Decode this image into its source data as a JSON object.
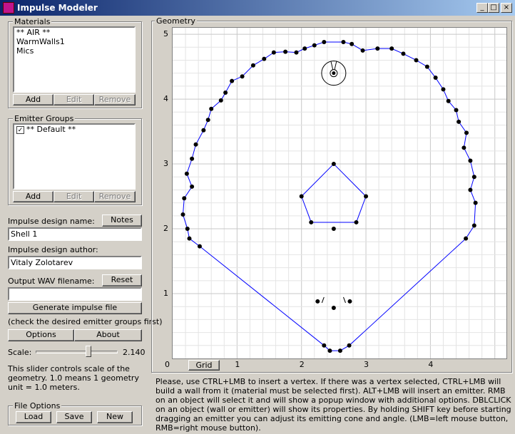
{
  "window": {
    "title": "Impulse Modeler",
    "minimize": "_",
    "maximize": "□",
    "close": "×"
  },
  "materials": {
    "legend": "Materials",
    "items": [
      "** AIR **",
      "WarmWalls1",
      "Mics"
    ],
    "add": "Add",
    "edit": "Edit",
    "remove": "Remove"
  },
  "emitter_groups": {
    "legend": "Emitter Groups",
    "items": [
      {
        "label": "** Default **",
        "checked": true
      }
    ],
    "check_mark": "✓",
    "add": "Add",
    "edit": "Edit",
    "remove": "Remove"
  },
  "design": {
    "name_label": "Impulse design name:",
    "notes": "Notes",
    "name_value": "Shell 1",
    "author_label": "Impulse design author:",
    "author_value": "Vitaly Zolotarev",
    "wav_label": "Output WAV filename:",
    "reset": "Reset",
    "wav_value": "",
    "generate": "Generate impulse file",
    "generate_hint": "(check the desired emitter groups first)",
    "options": "Options",
    "about": "About"
  },
  "scale": {
    "label": "Scale:",
    "value_text": "2.140",
    "slider_fraction": 0.64,
    "help": "This slider controls scale of the geometry. 1.0 means 1 geometry unit = 1.0 meters."
  },
  "file_options": {
    "legend": "File Options",
    "load": "Load",
    "save": "Save",
    "new": "New"
  },
  "geometry": {
    "legend": "Geometry",
    "grid_button": "Grid",
    "x_ticks": [
      "0",
      "1",
      "2",
      "3",
      "4"
    ],
    "y_ticks": [
      "1",
      "2",
      "3",
      "4",
      "5"
    ],
    "xlim": [
      0,
      5.18
    ],
    "ylim": [
      0,
      5.1
    ],
    "line_color": "#0000ff",
    "vertex_color": "#000000",
    "outer_wall": [
      [
        2.35,
        0.2
      ],
      [
        2.44,
        0.12
      ],
      [
        2.6,
        0.12
      ],
      [
        2.74,
        0.2
      ],
      [
        4.55,
        1.85
      ],
      [
        4.68,
        2.05
      ],
      [
        4.7,
        2.4
      ],
      [
        4.62,
        2.6
      ],
      [
        4.68,
        2.8
      ],
      [
        4.62,
        3.05
      ],
      [
        4.52,
        3.25
      ],
      [
        4.56,
        3.48
      ],
      [
        4.44,
        3.65
      ],
      [
        4.4,
        3.83
      ],
      [
        4.28,
        3.97
      ],
      [
        4.2,
        4.15
      ],
      [
        4.08,
        4.33
      ],
      [
        3.95,
        4.5
      ],
      [
        3.78,
        4.6
      ],
      [
        3.58,
        4.7
      ],
      [
        3.4,
        4.78
      ],
      [
        3.18,
        4.78
      ],
      [
        2.95,
        4.75
      ],
      [
        2.78,
        4.85
      ],
      [
        2.65,
        4.88
      ],
      [
        2.35,
        4.88
      ],
      [
        2.2,
        4.83
      ],
      [
        2.05,
        4.78
      ],
      [
        1.92,
        4.72
      ],
      [
        1.75,
        4.73
      ],
      [
        1.57,
        4.72
      ],
      [
        1.42,
        4.62
      ],
      [
        1.25,
        4.52
      ],
      [
        1.08,
        4.35
      ],
      [
        0.92,
        4.28
      ],
      [
        0.82,
        4.1
      ],
      [
        0.75,
        3.98
      ],
      [
        0.6,
        3.85
      ],
      [
        0.55,
        3.68
      ],
      [
        0.48,
        3.52
      ],
      [
        0.36,
        3.3
      ],
      [
        0.3,
        3.08
      ],
      [
        0.22,
        2.85
      ],
      [
        0.3,
        2.65
      ],
      [
        0.18,
        2.47
      ],
      [
        0.16,
        2.22
      ],
      [
        0.23,
        2.0
      ],
      [
        0.26,
        1.85
      ],
      [
        0.42,
        1.73
      ],
      [
        2.35,
        0.2
      ]
    ],
    "pentagon": [
      [
        2.5,
        3.0
      ],
      [
        3.0,
        2.5
      ],
      [
        2.85,
        2.1
      ],
      [
        2.15,
        2.1
      ],
      [
        2.0,
        2.5
      ],
      [
        2.5,
        3.0
      ]
    ],
    "pentagon_center": [
      2.5,
      2.0
    ],
    "top_emitter": [
      2.5,
      4.4
    ],
    "bottom_emitters": [
      [
        2.25,
        0.88
      ],
      [
        2.5,
        0.78
      ],
      [
        2.75,
        0.88
      ]
    ]
  },
  "help_text": "Please, use CTRL+LMB to insert a vertex. If there was a vertex selected, CTRL+LMB will build a wall from it (material must be selected first). ALT+LMB will insert an emitter. RMB on an object will select it and will show a popup window with additional options. DBLCLICK on an object (wall or emitter) will show its properties. By holding SHIFT key before starting dragging an emitter you can adjust its emitting cone and angle. (LMB=left mouse button, RMB=right mouse button)."
}
